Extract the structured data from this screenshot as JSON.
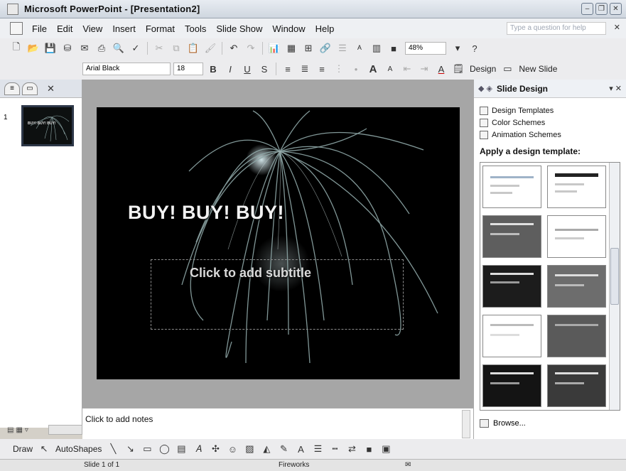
{
  "window": {
    "title": "Microsoft PowerPoint - [Presentation2]"
  },
  "menubar": {
    "items": [
      "File",
      "Edit",
      "View",
      "Insert",
      "Format",
      "Tools",
      "Slide Show",
      "Window",
      "Help"
    ],
    "help_placeholder": "Type a question for help"
  },
  "standard_toolbar": {
    "zoom": "48%"
  },
  "formatting_toolbar": {
    "font": "Arial Black",
    "size": "18",
    "bold": "B",
    "italic": "I",
    "underline": "U",
    "shadow": "S",
    "design_label": "Design",
    "new_slide_label": "New Slide"
  },
  "slides_panel": {
    "slide_number": "1",
    "thumb_title": "BUY! BUY! BUY!"
  },
  "slide": {
    "title": "BUY! BUY! BUY!",
    "subtitle_placeholder": "Click to add subtitle"
  },
  "notes": {
    "placeholder": "Click to add notes"
  },
  "task_pane": {
    "title": "Slide Design",
    "links": [
      "Design Templates",
      "Color Schemes",
      "Animation Schemes"
    ],
    "apply_label": "Apply a design template:",
    "browse_label": "Browse..."
  },
  "drawing_toolbar": {
    "draw_label": "Draw",
    "autoshapes_label": "AutoShapes"
  },
  "status": {
    "slide_info": "Slide 1 of 1",
    "design_name": "Fireworks"
  },
  "colors": {
    "slide_background": "#000000",
    "firework_stroke": "#8fa8a8",
    "pane_background": "#ffffff"
  }
}
